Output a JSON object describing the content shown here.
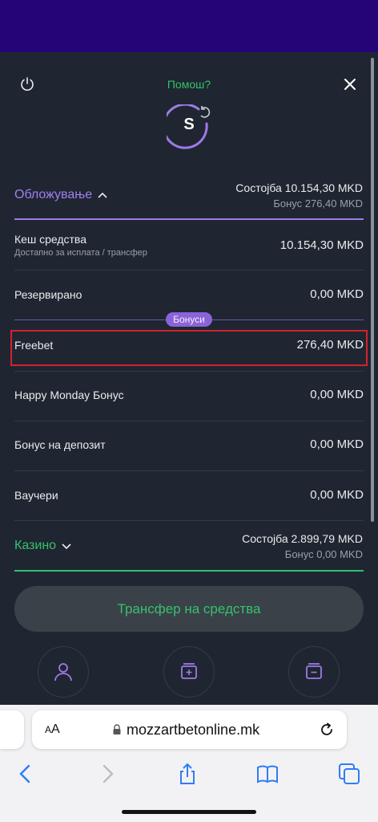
{
  "header": {
    "help": "Помош?",
    "avatar_letter": "S"
  },
  "betting": {
    "title": "Обложување",
    "state": "Состојба 10.154,30 MKD",
    "bonus": "Бонус 276,40 MKD",
    "rows": [
      {
        "label": "Кеш средства",
        "sub": "Достапно за исплата / трансфер",
        "value": "10.154,30 MKD"
      },
      {
        "label": "Резервирано",
        "value": "0,00 MKD"
      }
    ],
    "bonus_pill": "Бонуси",
    "bonus_rows": [
      {
        "label": "Freebet",
        "value": "276,40 MKD"
      },
      {
        "label": "Happy Monday Бонус",
        "value": "0,00 MKD"
      },
      {
        "label": "Бонус на депозит",
        "value": "0,00 MKD"
      },
      {
        "label": "Ваучери",
        "value": "0,00 MKD"
      }
    ]
  },
  "casino": {
    "title": "Казино",
    "state": "Состојба 2.899,79 MKD",
    "bonus": "Бонус 0,00 MKD"
  },
  "transfer_button": "Трансфер на средства",
  "browser": {
    "aa_small": "A",
    "aa_big": "A",
    "url": "mozzartbetonline.mk"
  },
  "colors": {
    "accent_purple": "#a27ff0",
    "accent_green": "#35c26b",
    "highlight_red": "#d2222d",
    "ios_blue": "#2f7cf6"
  }
}
